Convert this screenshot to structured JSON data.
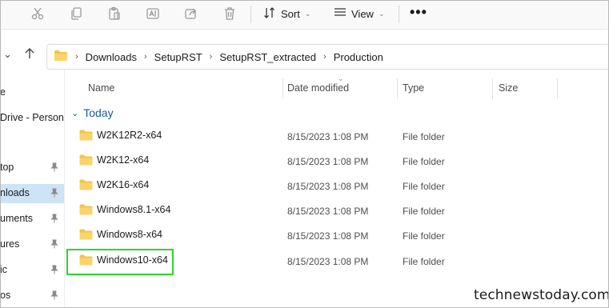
{
  "toolbar": {
    "icons": [
      "cut-icon",
      "copy-icon",
      "paste-icon",
      "rename-icon",
      "share-icon",
      "delete-icon"
    ],
    "sort_label": "Sort",
    "view_label": "View",
    "more_label": "•••"
  },
  "address": {
    "crumbs": [
      "Downloads",
      "SetupRST",
      "SetupRST_extracted",
      "Production"
    ]
  },
  "sidebar": {
    "items": [
      {
        "label": "e",
        "pinned": false,
        "active": false
      },
      {
        "label": "Drive - Persona",
        "pinned": false,
        "active": false
      },
      {
        "label": "top",
        "pinned": true,
        "active": false
      },
      {
        "label": "nloads",
        "pinned": true,
        "active": true
      },
      {
        "label": "uments",
        "pinned": true,
        "active": false
      },
      {
        "label": "ures",
        "pinned": true,
        "active": false
      },
      {
        "label": "ic",
        "pinned": true,
        "active": false
      },
      {
        "label": "os",
        "pinned": true,
        "active": false
      }
    ]
  },
  "columns": {
    "name": "Name",
    "date": "Date modified",
    "type": "Type",
    "size": "Size"
  },
  "group": {
    "label": "Today"
  },
  "rows": [
    {
      "name": "W2K12R2-x64",
      "date": "8/15/2023 1:08 PM",
      "type": "File folder"
    },
    {
      "name": "W2K12-x64",
      "date": "8/15/2023 1:08 PM",
      "type": "File folder"
    },
    {
      "name": "W2K16-x64",
      "date": "8/15/2023 1:08 PM",
      "type": "File folder"
    },
    {
      "name": "Windows8.1-x64",
      "date": "8/15/2023 1:08 PM",
      "type": "File folder"
    },
    {
      "name": "Windows8-x64",
      "date": "8/15/2023 1:08 PM",
      "type": "File folder"
    },
    {
      "name": "Windows10-x64",
      "date": "8/15/2023 1:08 PM",
      "type": "File folder"
    }
  ],
  "watermark": "technewstoday.com",
  "colors": {
    "accent": "#1a5a9a",
    "highlight": "#2bd62b",
    "folder": "#f6c343",
    "active_nav": "#cde4f7"
  }
}
